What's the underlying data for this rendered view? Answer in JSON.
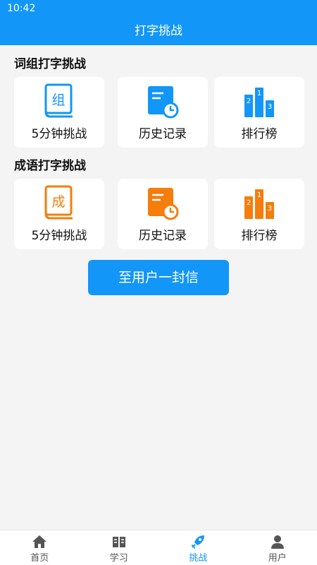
{
  "status_bar": {
    "time": "10:42"
  },
  "header": {
    "title": "打字挑战"
  },
  "colors": {
    "primary": "#1296f7",
    "orange": "#f57d0c",
    "nav_inactive": "#555555"
  },
  "sections": [
    {
      "title": "词组打字挑战",
      "book_char": "组",
      "tiles": [
        {
          "label": "5分钟挑战",
          "icon": "book-icon"
        },
        {
          "label": "历史记录",
          "icon": "history-icon"
        },
        {
          "label": "排行榜",
          "icon": "podium-icon"
        }
      ]
    },
    {
      "title": "成语打字挑战",
      "book_char": "成",
      "tiles": [
        {
          "label": "5分钟挑战",
          "icon": "book-icon"
        },
        {
          "label": "历史记录",
          "icon": "history-icon"
        },
        {
          "label": "排行榜",
          "icon": "podium-icon"
        }
      ]
    }
  ],
  "podium_ranks": [
    "1",
    "2",
    "3"
  ],
  "letter_button": {
    "label": "至用户一封信"
  },
  "bottom_nav": {
    "active": "挑战",
    "items": [
      {
        "label": "首页",
        "icon": "home-icon"
      },
      {
        "label": "学习",
        "icon": "open-book-icon"
      },
      {
        "label": "挑战",
        "icon": "rocket-icon"
      },
      {
        "label": "用户",
        "icon": "user-icon"
      }
    ]
  }
}
